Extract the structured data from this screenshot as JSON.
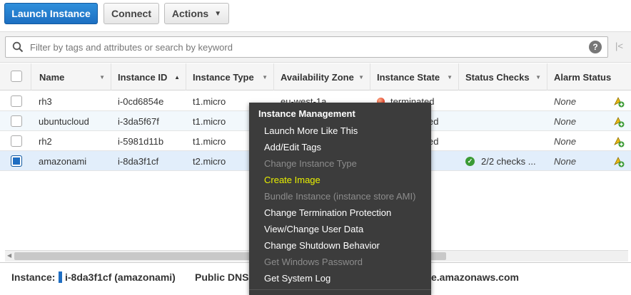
{
  "toolbar": {
    "launch_label": "Launch Instance",
    "connect_label": "Connect",
    "actions_label": "Actions"
  },
  "filter": {
    "placeholder": "Filter by tags and attributes or search by keyword",
    "help": "?",
    "first_page": "|<"
  },
  "columns": [
    "Name",
    "Instance ID",
    "Instance Type",
    "Availability Zone",
    "Instance State",
    "Status Checks",
    "Alarm Status"
  ],
  "rows": [
    {
      "name": "rh3",
      "id": "i-0cd6854e",
      "type": "t1.micro",
      "zone": "eu-west-1a",
      "state": "terminated",
      "checks": "",
      "alarm": "None",
      "checked": false
    },
    {
      "name": "ubuntucloud",
      "id": "i-3da5f67f",
      "type": "t1.micro",
      "zone": "",
      "state": "ed",
      "checks": "",
      "alarm": "None",
      "checked": false
    },
    {
      "name": "rh2",
      "id": "i-5981d11b",
      "type": "t1.micro",
      "zone": "",
      "state": "ed",
      "checks": "",
      "alarm": "None",
      "checked": false
    },
    {
      "name": "amazonami",
      "id": "i-8da3f1cf",
      "type": "t2.micro",
      "zone": "",
      "state": "",
      "checks": "2/2 checks ...",
      "alarm": "None",
      "checked": true
    }
  ],
  "detail": {
    "instance_label": "Instance:",
    "instance_value": "i-8da3f1cf (amazonami)",
    "dns_label": "Public DNS",
    "dns_value": "e.amazonaws.com"
  },
  "context_menu": {
    "header": "Instance Management",
    "items": [
      {
        "label": "Launch More Like This",
        "state": "enabled"
      },
      {
        "label": "Add/Edit Tags",
        "state": "enabled"
      },
      {
        "label": "Change Instance Type",
        "state": "disabled"
      },
      {
        "label": "Create Image",
        "state": "highlighted"
      },
      {
        "label": "Bundle Instance (instance store AMI)",
        "state": "disabled"
      },
      {
        "label": "Change Termination Protection",
        "state": "enabled"
      },
      {
        "label": "View/Change User Data",
        "state": "enabled"
      },
      {
        "label": "Change Shutdown Behavior",
        "state": "enabled"
      },
      {
        "label": "Get Windows Password",
        "state": "disabled"
      },
      {
        "label": "Get System Log",
        "state": "enabled"
      }
    ]
  },
  "colors": {
    "primary": "#1c6fc2",
    "menu_bg": "#3c3c3c",
    "menu_highlight": "#e9f000",
    "state_terminated": "#e0402a",
    "check_ok": "#3b9b35"
  },
  "icons": {
    "search": "search-icon",
    "help": "help-icon",
    "alarm": "add-alarm-icon",
    "ok": "check-ok-icon",
    "state": "state-dot-icon"
  }
}
